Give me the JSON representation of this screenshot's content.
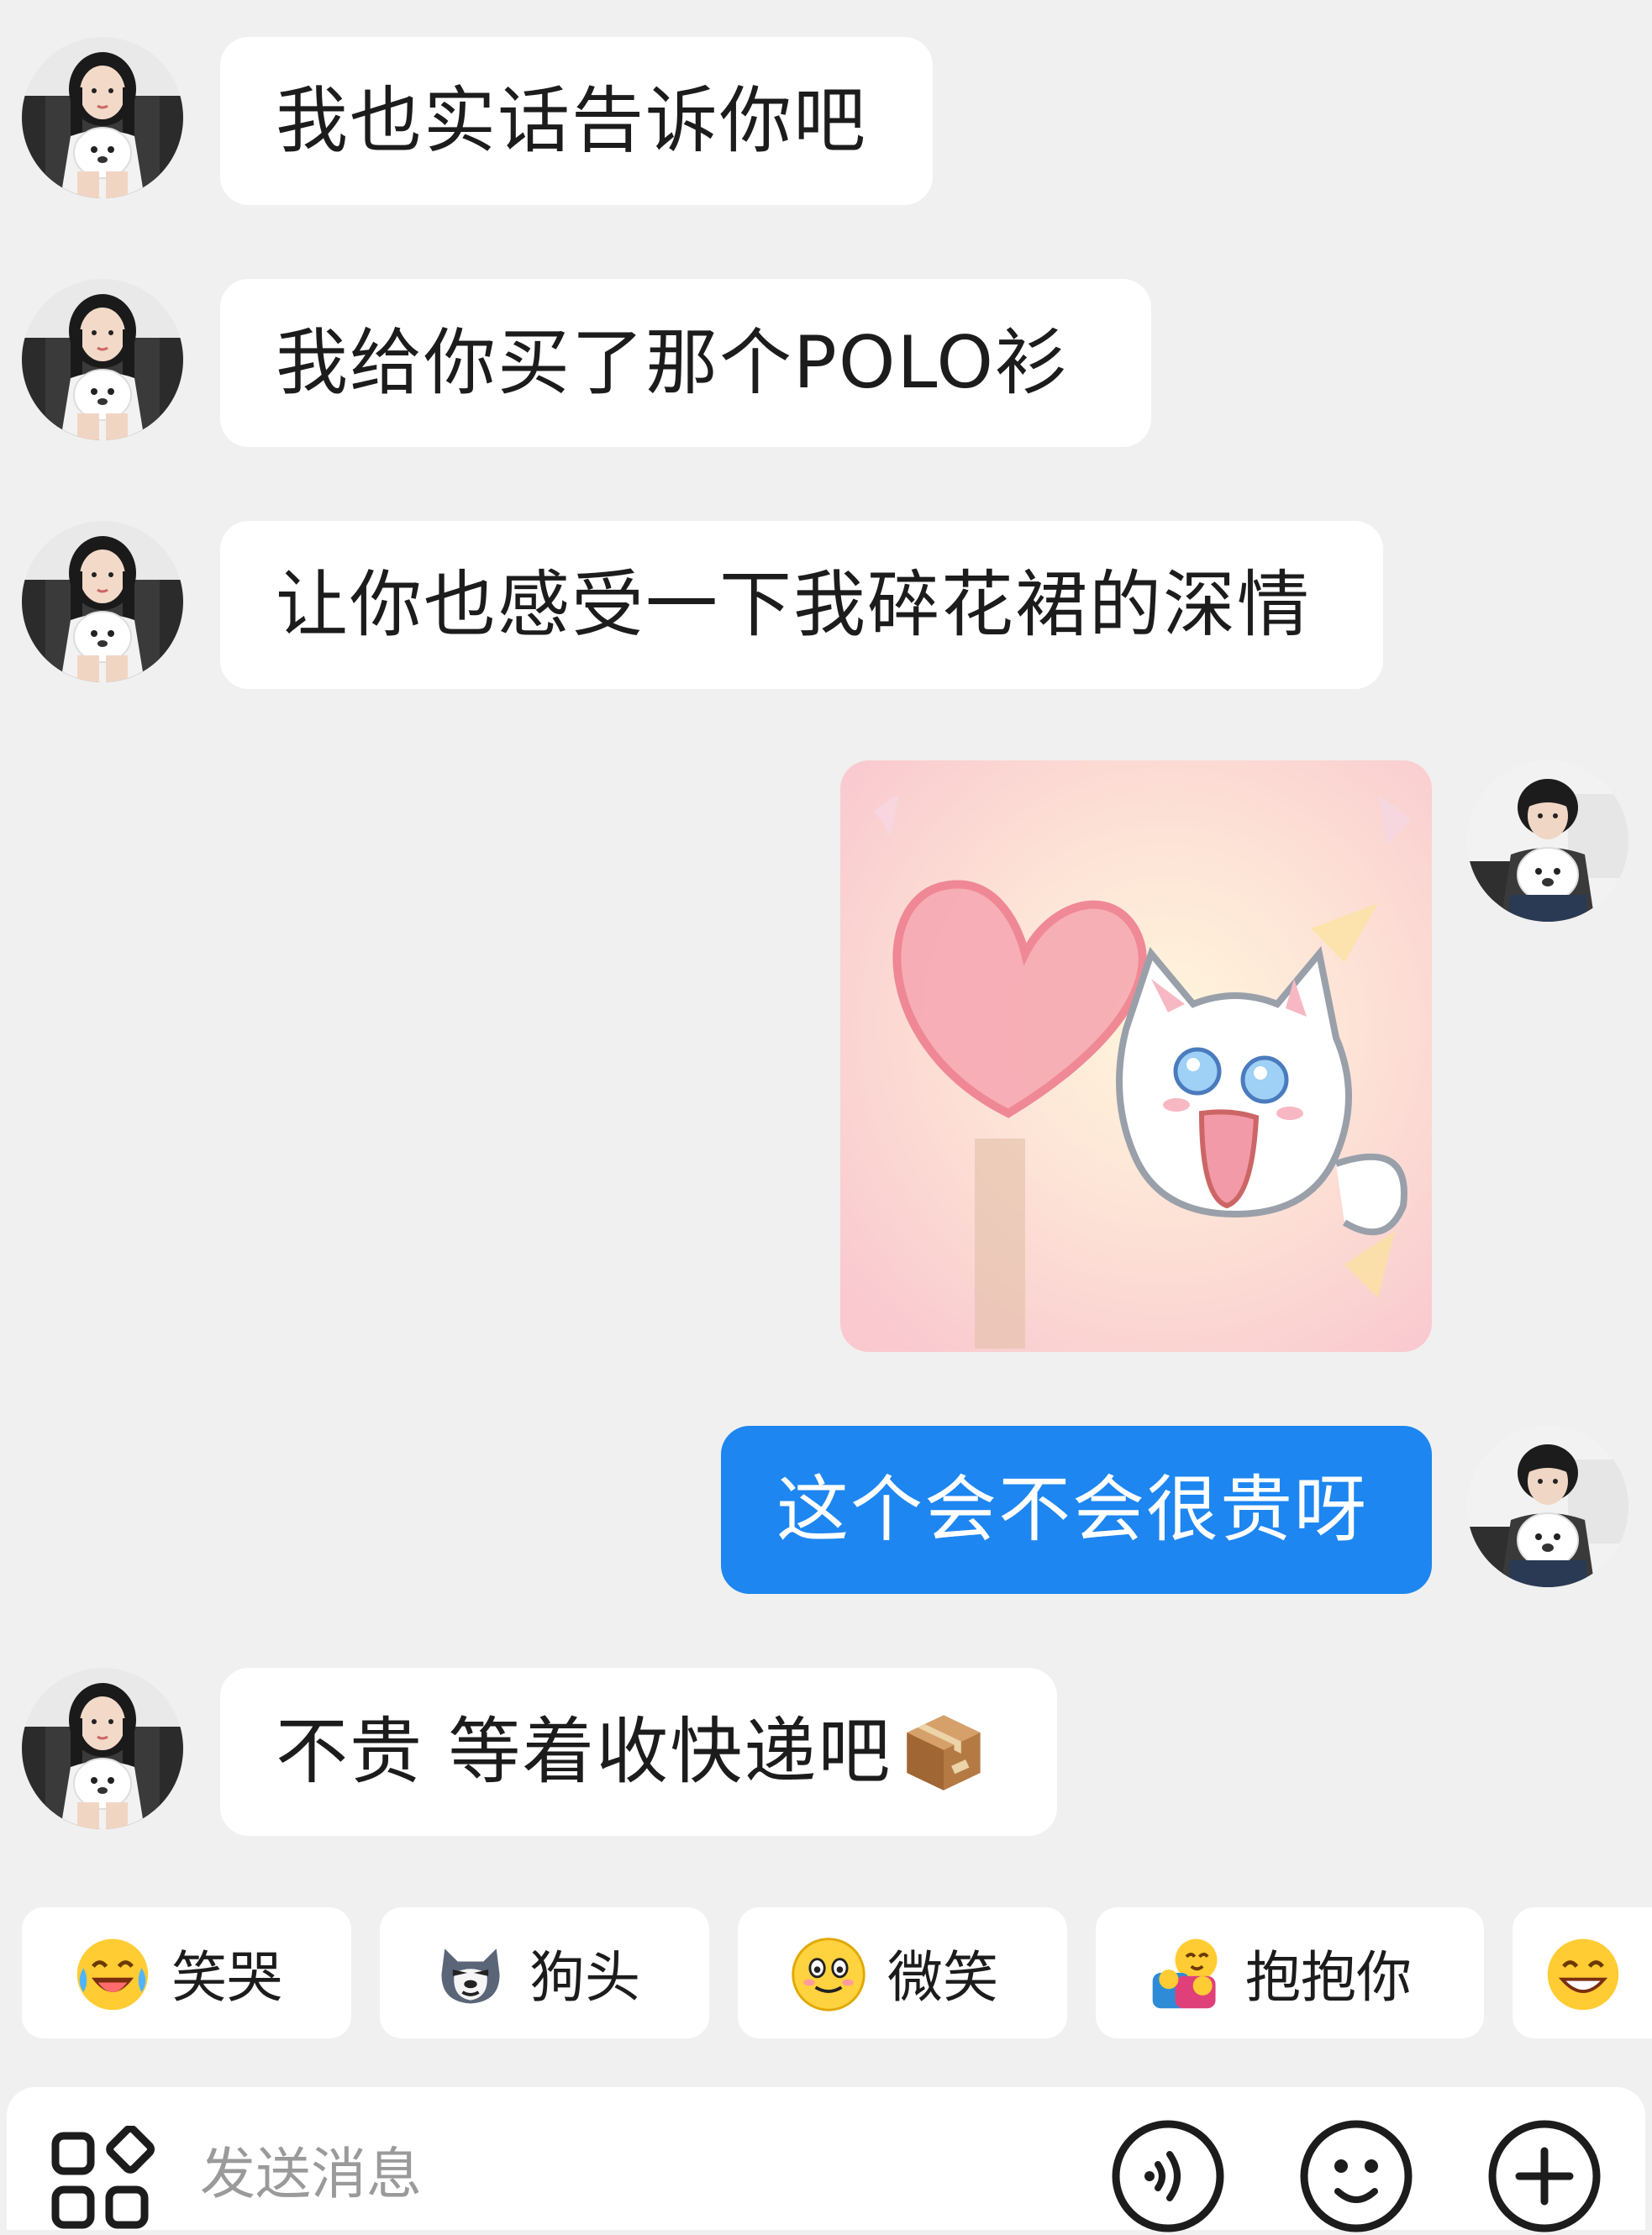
{
  "messages": [
    {
      "side": "left",
      "text": "我也实话告诉你吧"
    },
    {
      "side": "left",
      "text": "我给你买了那个POLO衫"
    },
    {
      "side": "left",
      "text": "让你也感受一下我碎花裙的深情"
    },
    {
      "side": "right",
      "type": "sticker",
      "sticker": "cat-heart-sticker"
    },
    {
      "side": "right",
      "text": "这个会不会很贵呀"
    },
    {
      "side": "left",
      "text": "不贵 等着收快递吧",
      "emoji": "package-icon"
    }
  ],
  "quick_replies": [
    {
      "label": "笑哭",
      "icon": "laugh-cry-emoji"
    },
    {
      "label": "狗头",
      "icon": "dog-head-emoji"
    },
    {
      "label": "微笑",
      "icon": "smile-emoji"
    },
    {
      "label": "抱抱你",
      "icon": "hug-emoji"
    },
    {
      "label": "",
      "icon": "grin-emoji"
    }
  ],
  "input": {
    "placeholder": "发送消息"
  },
  "toolbar": {
    "apps_icon": "apps-icon",
    "voice_icon": "voice-icon",
    "emoji_icon": "emoji-face-icon",
    "add_icon": "add-icon"
  },
  "colors": {
    "background": "#f0f0f0",
    "bubble_left": "#ffffff",
    "bubble_right": "#1d86f0",
    "placeholder": "#9a9a9a"
  }
}
